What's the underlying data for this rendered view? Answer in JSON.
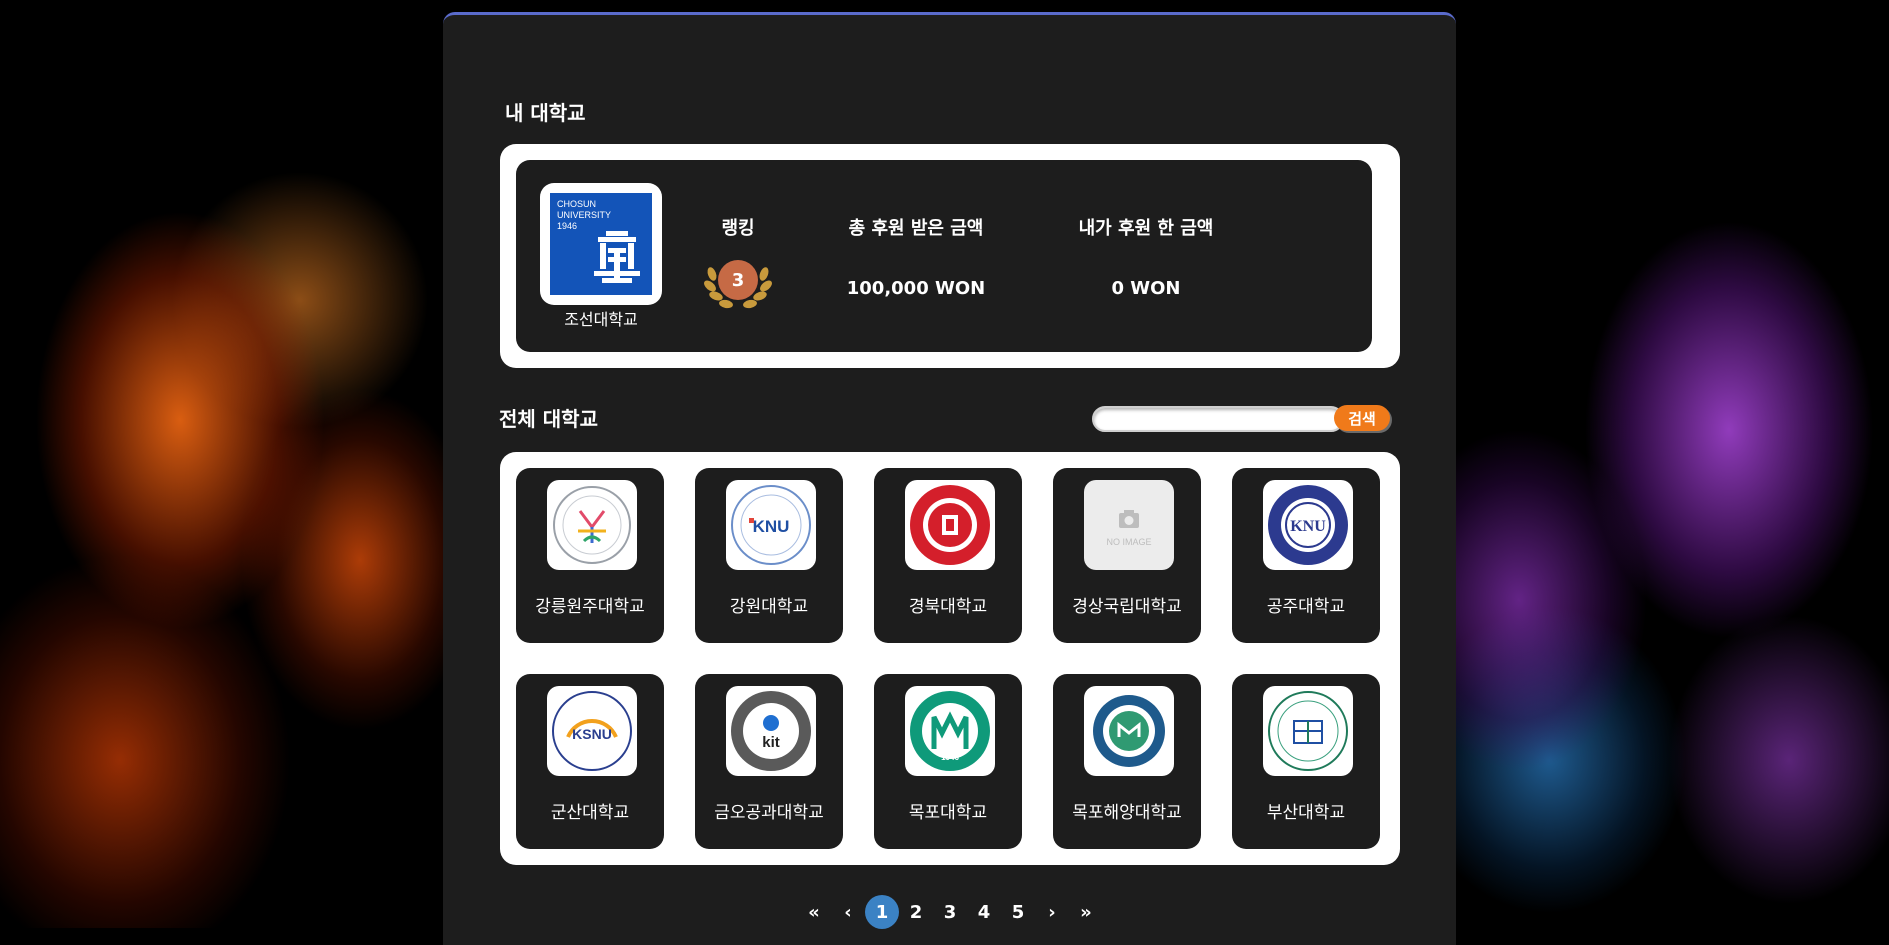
{
  "my_university": {
    "section_title": "내 대학교",
    "name": "조선대학교",
    "logo_text": [
      "CHOSUN",
      "UNIVERSITY",
      "1946"
    ],
    "rank_label": "랭킹",
    "rank": "3",
    "total_received_label": "총 후원 받은 금액",
    "total_received": "100,000 WON",
    "my_donation_label": "내가 후원 한 금액",
    "my_donation": "0 WON"
  },
  "all_universities": {
    "section_title": "전체 대학교",
    "search": {
      "placeholder": "",
      "button_label": "검색"
    },
    "items": [
      {
        "name": "강릉원주대학교",
        "logo": "gwnu-seal"
      },
      {
        "name": "강원대학교",
        "logo": "knu-seal",
        "logo_text": "KNU"
      },
      {
        "name": "경북대학교",
        "logo": "kyungpook-seal"
      },
      {
        "name": "경상국립대학교",
        "logo": "no-image",
        "logo_text": "NO IMAGE"
      },
      {
        "name": "공주대학교",
        "logo": "kongju-seal",
        "logo_text": "KNU"
      },
      {
        "name": "군산대학교",
        "logo": "ksnu-seal",
        "logo_text": "KSNU"
      },
      {
        "name": "금오공과대학교",
        "logo": "kit-seal",
        "logo_text": "kit"
      },
      {
        "name": "목포대학교",
        "logo": "mokpo-seal",
        "logo_text": "1946"
      },
      {
        "name": "목포해양대학교",
        "logo": "mmu-seal"
      },
      {
        "name": "부산대학교",
        "logo": "pusan-seal"
      }
    ]
  },
  "pagination": {
    "first": "«",
    "prev": "‹",
    "pages": [
      "1",
      "2",
      "3",
      "4",
      "5"
    ],
    "current": "1",
    "next": "›",
    "last": "»"
  },
  "colors": {
    "panel": "#1d1d1d",
    "accent_orange": "#f07a1a",
    "rank_bronze": "#c66a45",
    "pagination_active": "#3b82c4",
    "chosun_blue": "#1354b8"
  }
}
